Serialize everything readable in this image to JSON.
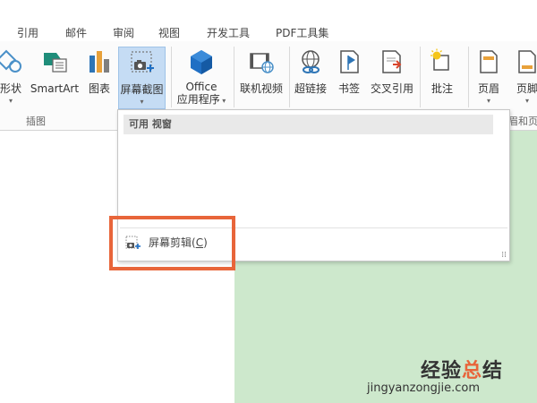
{
  "tabs": [
    "引用",
    "邮件",
    "审阅",
    "视图",
    "开发工具",
    "PDF工具集"
  ],
  "ribbon": {
    "buttons": {
      "shapes": "形状",
      "smartart": "SmartArt",
      "chart": "图表",
      "screenshot": "屏幕截图",
      "office_line1": "Office",
      "office_line2": "应用程序",
      "online_video": "联机视频",
      "hyperlink": "超链接",
      "bookmark": "书签",
      "cross_ref": "交叉引用",
      "comment": "批注",
      "header": "页眉",
      "footer": "页脚"
    },
    "groups": {
      "illustrations": "插图",
      "header_footer_partial": "眉和页"
    }
  },
  "dropdown": {
    "header": "可用 视窗",
    "item_label": "屏幕剪辑(",
    "item_hotkey": "C",
    "item_close": ")"
  },
  "watermark": {
    "cn_part1": "经验",
    "cn_part2": "总",
    "cn_part3": "结",
    "url": "jingyanzongjie.com"
  },
  "colors": {
    "highlight_border": "#e8653a",
    "screenshot_button_bg": "#c5dcf4",
    "document_green": "#cde8cc"
  }
}
